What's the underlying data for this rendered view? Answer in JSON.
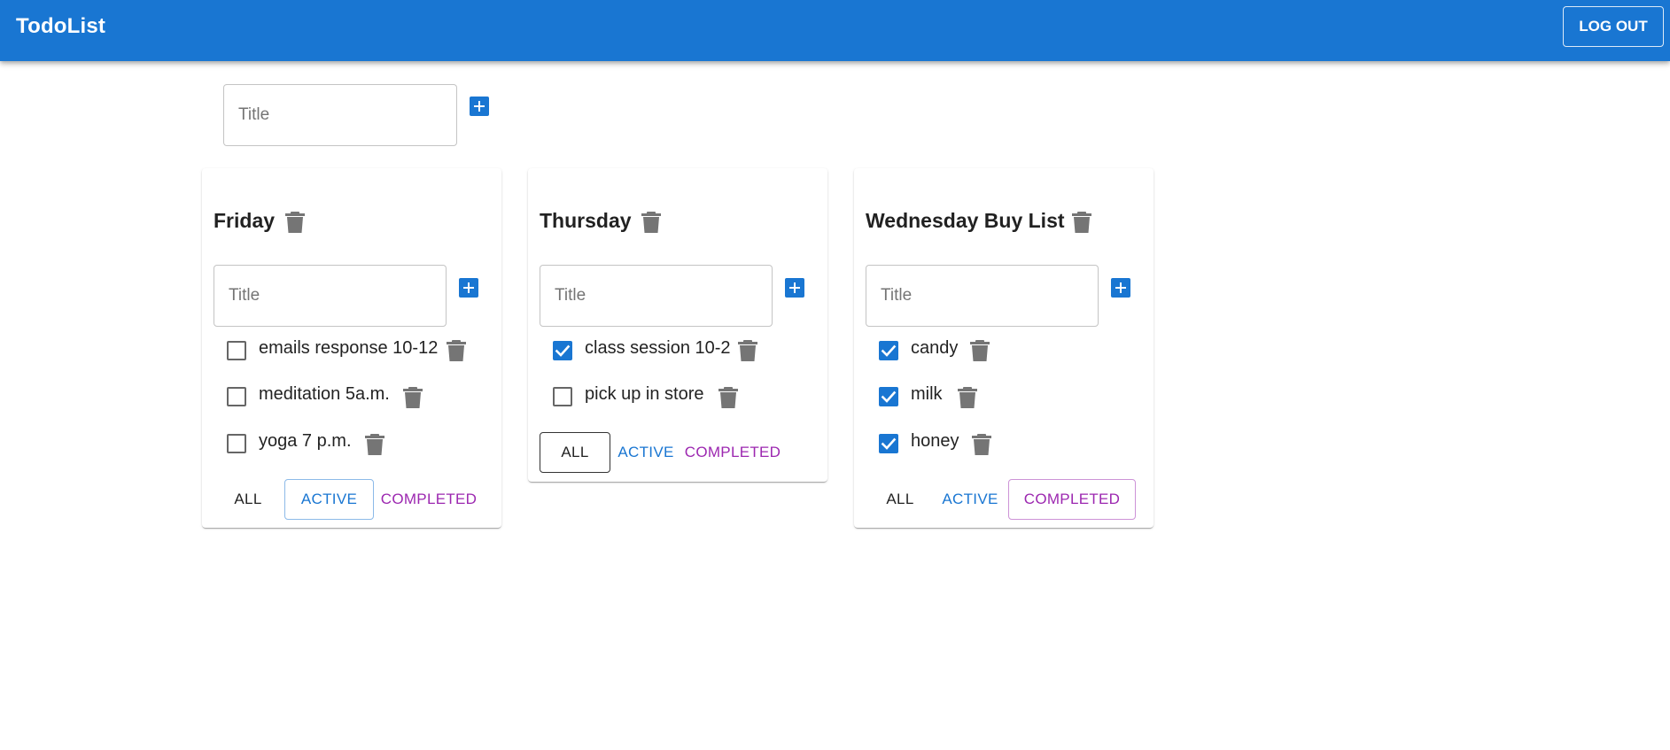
{
  "app": {
    "title": "TodoList",
    "logout_label": "LOG OUT"
  },
  "new_list": {
    "placeholder": "Title"
  },
  "colors": {
    "primary": "#1976d2",
    "secondary": "#9c27b0",
    "icon_gray": "#757575"
  },
  "lists": [
    {
      "title": "Friday",
      "input_placeholder": "Title",
      "active_filter": "active",
      "tasks": [
        {
          "label": "emails response 10-12",
          "done": false
        },
        {
          "label": "meditation 5a.m.",
          "done": false
        },
        {
          "label": "yoga 7 p.m.",
          "done": false
        }
      ],
      "filters": {
        "all": "ALL",
        "active": "ACTIVE",
        "completed": "COMPLETED"
      }
    },
    {
      "title": "Thursday",
      "input_placeholder": "Title",
      "active_filter": "all",
      "tasks": [
        {
          "label": "class session 10-2",
          "done": true
        },
        {
          "label": "pick up in store",
          "done": false
        }
      ],
      "filters": {
        "all": "ALL",
        "active": "ACTIVE",
        "completed": "COMPLETED"
      }
    },
    {
      "title": "Wednesday Buy List",
      "input_placeholder": "Title",
      "active_filter": "completed",
      "tasks": [
        {
          "label": "candy",
          "done": true
        },
        {
          "label": "milk",
          "done": true
        },
        {
          "label": "honey",
          "done": true
        }
      ],
      "filters": {
        "all": "ALL",
        "active": "ACTIVE",
        "completed": "COMPLETED"
      }
    }
  ]
}
